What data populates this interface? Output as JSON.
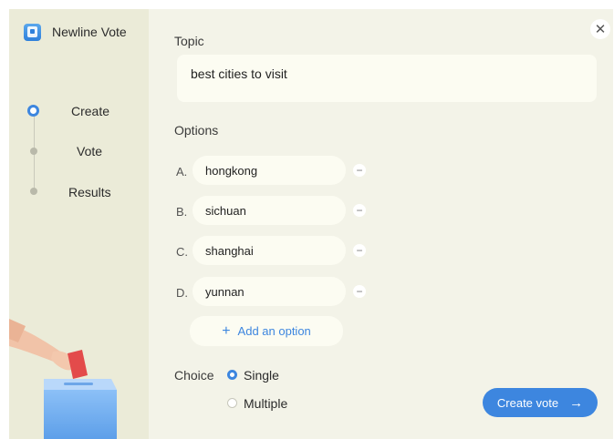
{
  "app": {
    "title": "Newline Vote"
  },
  "steps": [
    {
      "label": "Create"
    },
    {
      "label": "Vote"
    },
    {
      "label": "Results"
    }
  ],
  "topic": {
    "label": "Topic",
    "value": "best cities to visit"
  },
  "options": {
    "label": "Options",
    "items": [
      {
        "letter": "A.",
        "value": "hongkong"
      },
      {
        "letter": "B.",
        "value": "sichuan"
      },
      {
        "letter": "C.",
        "value": "shanghai"
      },
      {
        "letter": "D.",
        "value": "yunnan"
      }
    ],
    "add_label": "Add an option"
  },
  "choice": {
    "label": "Choice",
    "single": "Single",
    "multiple": "Multiple",
    "selected": "Single"
  },
  "actions": {
    "create": "Create vote"
  },
  "colors": {
    "accent": "#3d86df",
    "sidebar_bg": "#ebebd8",
    "panel_bg": "#f3f3e8"
  },
  "icons": [
    "app-logo-icon",
    "close-icon",
    "minus-icon",
    "plus-icon",
    "arrow-right-icon"
  ]
}
